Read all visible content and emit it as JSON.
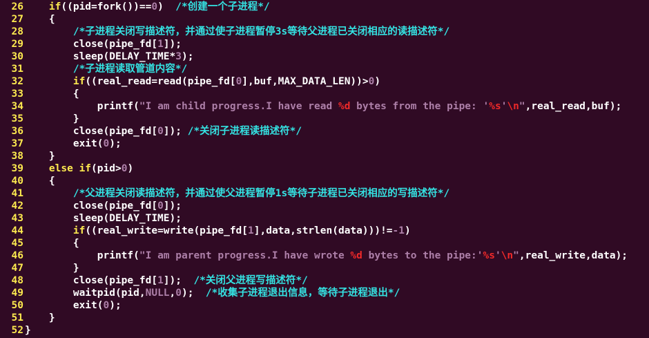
{
  "window": {
    "background": "#300a24",
    "colors": {
      "line_number": "#fce94f",
      "keyword": "#fce94f",
      "comment": "#34e2e2",
      "number": "#ad7fa8",
      "string": "#ad7fa8",
      "format_specifier": "#ef2929",
      "text": "#ffffff"
    }
  },
  "editor": {
    "lines": [
      {
        "num": "26",
        "tokens": [
          {
            "t": "    ",
            "c": "tx"
          },
          {
            "t": "if",
            "c": "kw"
          },
          {
            "t": "((pid=fork())==",
            "c": "tx"
          },
          {
            "t": "0",
            "c": "num"
          },
          {
            "t": ")  ",
            "c": "tx"
          },
          {
            "t": "/*创建一个子进程*/",
            "c": "cm"
          }
        ]
      },
      {
        "num": "27",
        "tokens": [
          {
            "t": "    {",
            "c": "tx"
          }
        ]
      },
      {
        "num": "28",
        "tokens": [
          {
            "t": "        ",
            "c": "tx"
          },
          {
            "t": "/*子进程关闭写描述符，并通过使子进程暂停3s等待父进程已关闭相应的读描述符*/",
            "c": "cm"
          }
        ]
      },
      {
        "num": "29",
        "tokens": [
          {
            "t": "        close(pipe_fd[",
            "c": "tx"
          },
          {
            "t": "1",
            "c": "num"
          },
          {
            "t": "]);",
            "c": "tx"
          }
        ]
      },
      {
        "num": "30",
        "tokens": [
          {
            "t": "        sleep(DELAY_TIME*",
            "c": "tx"
          },
          {
            "t": "3",
            "c": "num"
          },
          {
            "t": ");",
            "c": "tx"
          }
        ]
      },
      {
        "num": "31",
        "tokens": [
          {
            "t": "        ",
            "c": "tx"
          },
          {
            "t": "/*子进程读取管道内容*/",
            "c": "cm"
          }
        ]
      },
      {
        "num": "32",
        "tokens": [
          {
            "t": "        ",
            "c": "tx"
          },
          {
            "t": "if",
            "c": "kw"
          },
          {
            "t": "((real_read=read(pipe_fd[",
            "c": "tx"
          },
          {
            "t": "0",
            "c": "num"
          },
          {
            "t": "],buf,MAX_DATA_LEN))>",
            "c": "tx"
          },
          {
            "t": "0",
            "c": "num"
          },
          {
            "t": ")",
            "c": "tx"
          }
        ]
      },
      {
        "num": "33",
        "tokens": [
          {
            "t": "        {",
            "c": "tx"
          }
        ]
      },
      {
        "num": "34",
        "tokens": [
          {
            "t": "            printf(",
            "c": "tx"
          },
          {
            "t": "\"I am child progress.I have read ",
            "c": "str"
          },
          {
            "t": "%d",
            "c": "sp"
          },
          {
            "t": " bytes from the pipe: '",
            "c": "str"
          },
          {
            "t": "%s",
            "c": "sp"
          },
          {
            "t": "'",
            "c": "str"
          },
          {
            "t": "\\n",
            "c": "sp"
          },
          {
            "t": "\"",
            "c": "str"
          },
          {
            "t": ",real_read,buf);",
            "c": "tx"
          }
        ]
      },
      {
        "num": "35",
        "tokens": [
          {
            "t": "        }",
            "c": "tx"
          }
        ]
      },
      {
        "num": "36",
        "tokens": [
          {
            "t": "        close(pipe_fd[",
            "c": "tx"
          },
          {
            "t": "0",
            "c": "num"
          },
          {
            "t": "]); ",
            "c": "tx"
          },
          {
            "t": "/*关闭子进程读描述符*/",
            "c": "cm"
          }
        ]
      },
      {
        "num": "37",
        "tokens": [
          {
            "t": "        exit(",
            "c": "tx"
          },
          {
            "t": "0",
            "c": "num"
          },
          {
            "t": ");",
            "c": "tx"
          }
        ]
      },
      {
        "num": "38",
        "tokens": [
          {
            "t": "    }",
            "c": "tx"
          }
        ]
      },
      {
        "num": "39",
        "tokens": [
          {
            "t": "    ",
            "c": "tx"
          },
          {
            "t": "else",
            "c": "kw"
          },
          {
            "t": " ",
            "c": "tx"
          },
          {
            "t": "if",
            "c": "kw"
          },
          {
            "t": "(pid>",
            "c": "tx"
          },
          {
            "t": "0",
            "c": "num"
          },
          {
            "t": ")",
            "c": "tx"
          }
        ]
      },
      {
        "num": "40",
        "tokens": [
          {
            "t": "    {",
            "c": "tx"
          }
        ]
      },
      {
        "num": "41",
        "tokens": [
          {
            "t": "        ",
            "c": "tx"
          },
          {
            "t": "/*父进程关闭读描述符，并通过使父进程暂停1s等待子进程已关闭相应的写描述符*/",
            "c": "cm"
          }
        ]
      },
      {
        "num": "42",
        "tokens": [
          {
            "t": "        close(pipe_fd[",
            "c": "tx"
          },
          {
            "t": "0",
            "c": "num"
          },
          {
            "t": "]);",
            "c": "tx"
          }
        ]
      },
      {
        "num": "43",
        "tokens": [
          {
            "t": "        sleep(DELAY_TIME);",
            "c": "tx"
          }
        ]
      },
      {
        "num": "44",
        "tokens": [
          {
            "t": "        ",
            "c": "tx"
          },
          {
            "t": "if",
            "c": "kw"
          },
          {
            "t": "((real_write=write(pipe_fd[",
            "c": "tx"
          },
          {
            "t": "1",
            "c": "num"
          },
          {
            "t": "],data,strlen(data)))!=",
            "c": "tx"
          },
          {
            "t": "-1",
            "c": "num"
          },
          {
            "t": ")",
            "c": "tx"
          }
        ]
      },
      {
        "num": "45",
        "tokens": [
          {
            "t": "        {",
            "c": "tx"
          }
        ]
      },
      {
        "num": "46",
        "tokens": [
          {
            "t": "            printf(",
            "c": "tx"
          },
          {
            "t": "\"I am parent progress.I have wrote ",
            "c": "str"
          },
          {
            "t": "%d",
            "c": "sp"
          },
          {
            "t": " bytes to the pipe:'",
            "c": "str"
          },
          {
            "t": "%s",
            "c": "sp"
          },
          {
            "t": "'",
            "c": "str"
          },
          {
            "t": "\\n",
            "c": "sp"
          },
          {
            "t": "\"",
            "c": "str"
          },
          {
            "t": ",real_write,data);",
            "c": "tx"
          }
        ]
      },
      {
        "num": "47",
        "tokens": [
          {
            "t": "        }",
            "c": "tx"
          }
        ]
      },
      {
        "num": "48",
        "tokens": [
          {
            "t": "        close(pipe_fd[",
            "c": "tx"
          },
          {
            "t": "1",
            "c": "num"
          },
          {
            "t": "]);  ",
            "c": "tx"
          },
          {
            "t": "/*关闭父进程写描述符*/",
            "c": "cm"
          }
        ]
      },
      {
        "num": "49",
        "tokens": [
          {
            "t": "        waitpid(pid,",
            "c": "tx"
          },
          {
            "t": "NULL",
            "c": "num"
          },
          {
            "t": ",",
            "c": "tx"
          },
          {
            "t": "0",
            "c": "num"
          },
          {
            "t": ");  ",
            "c": "tx"
          },
          {
            "t": "/*收集子进程退出信息，等待子进程退出*/",
            "c": "cm"
          }
        ]
      },
      {
        "num": "50",
        "tokens": [
          {
            "t": "        exit(",
            "c": "tx"
          },
          {
            "t": "0",
            "c": "num"
          },
          {
            "t": ");",
            "c": "tx"
          }
        ]
      },
      {
        "num": "51",
        "tokens": [
          {
            "t": "    }",
            "c": "tx"
          }
        ]
      },
      {
        "num": "52",
        "tokens": [
          {
            "t": "}",
            "c": "tx"
          }
        ]
      }
    ]
  }
}
